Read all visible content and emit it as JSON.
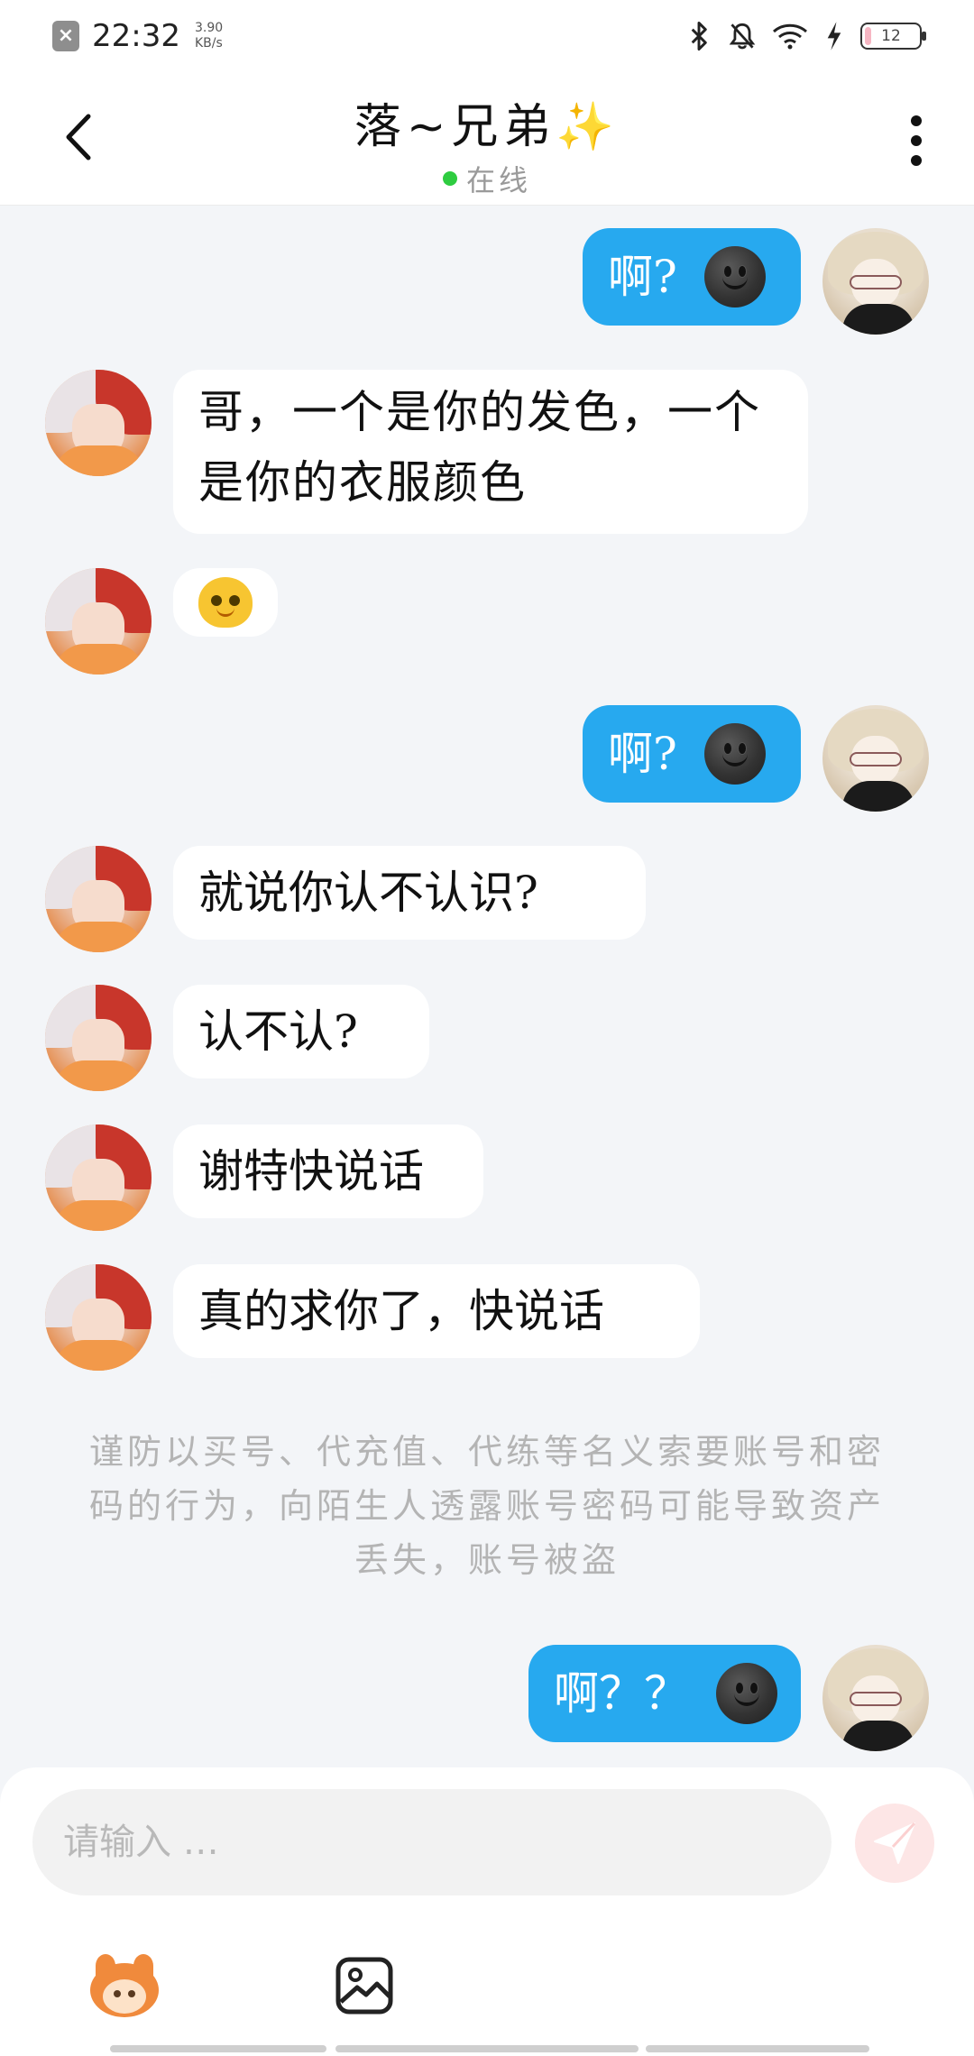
{
  "status_bar": {
    "time": "22:32",
    "speed_value": "3.90",
    "speed_unit": "KB/s",
    "battery": "12",
    "battery_level": 0.12
  },
  "header": {
    "title": "落~兄弟",
    "title_emoji": "✨",
    "status": "在线"
  },
  "messages": [
    {
      "from": "me",
      "text": "啊?"
    },
    {
      "from": "friend",
      "text": "哥，一个是你的发色，一个是你的衣服颜色"
    },
    {
      "from": "friend",
      "type": "sticker"
    },
    {
      "from": "me",
      "text": "啊?"
    },
    {
      "from": "friend",
      "text": "就说你认不认识?"
    },
    {
      "from": "friend",
      "text": "认不认?"
    },
    {
      "from": "friend",
      "text": "谢特快说话"
    },
    {
      "from": "friend",
      "text": "真的求你了，快说话"
    },
    {
      "from": "me",
      "text": "啊？？"
    }
  ],
  "notice": "谨防以买号、代充值、代练等名义索要账号和密码的行为，向陌生人透露账号密码可能导致资产丢失，账号被盗",
  "input": {
    "placeholder": "请输入 …"
  },
  "icons": {
    "back": "chevron-left-icon",
    "more": "more-vertical-icon",
    "send": "send-icon",
    "sticker": "mascot-sticker-icon",
    "image": "image-icon"
  },
  "colors": {
    "outgoing_bubble": "#27a9ef",
    "incoming_bubble": "#ffffff",
    "background": "#f3f5f8",
    "online_dot": "#2ecc40"
  }
}
